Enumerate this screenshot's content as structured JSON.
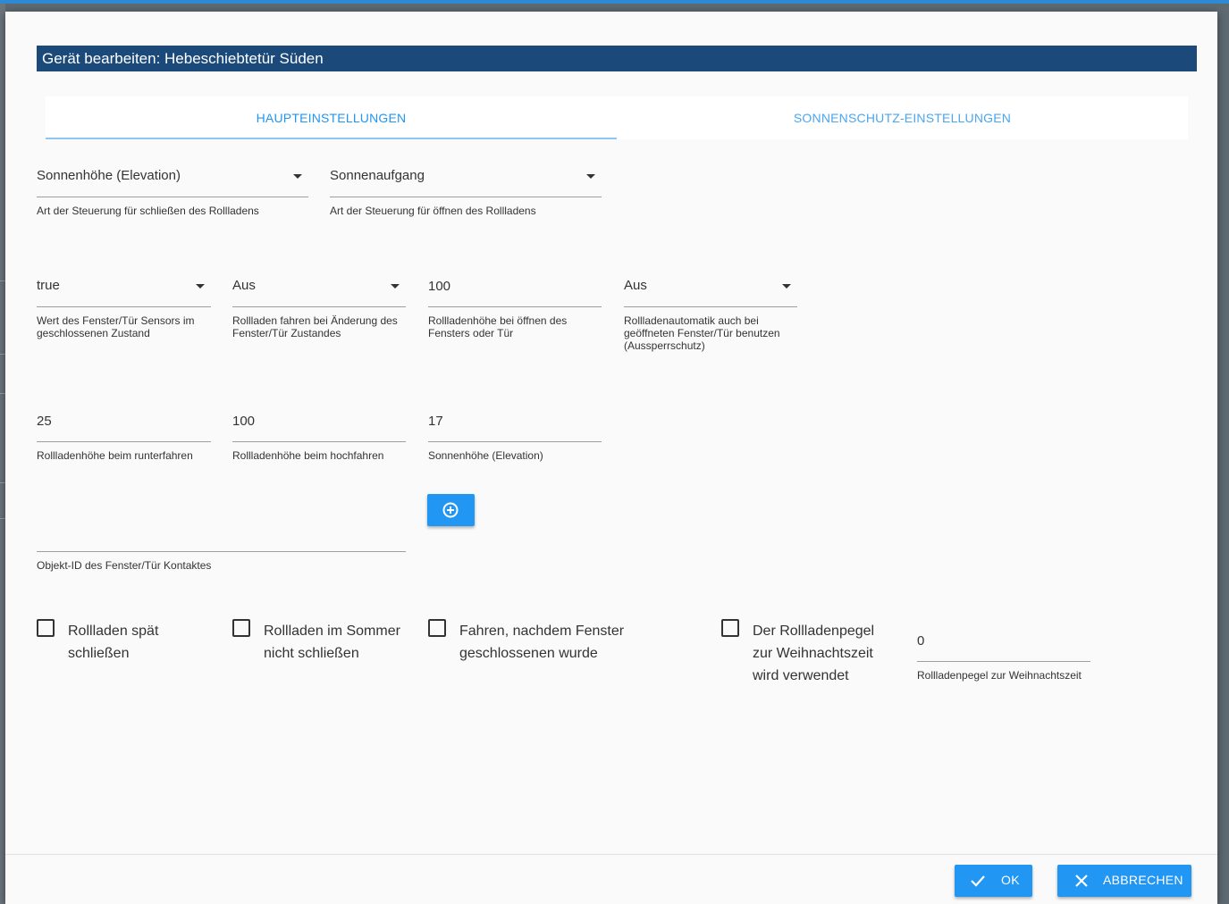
{
  "dialog": {
    "title": "Gerät bearbeiten: Hebeschiebtetür Süden"
  },
  "tabs": [
    {
      "label": "HAUPTEINSTELLUNGEN",
      "active": true
    },
    {
      "label": "SONNENSCHUTZ-EINSTELLUNGEN",
      "active": false
    }
  ],
  "fields": {
    "close_type": {
      "value": "Sonnenhöhe (Elevation)",
      "help": "Art der Steuerung für schließen des Rollladens"
    },
    "open_type": {
      "value": "Sonnenaufgang",
      "help": "Art der Steuerung für öffnen des Rollladens"
    },
    "sensor_closed_value": {
      "value": "true",
      "help": "Wert des Fenster/Tür Sensors im geschlossenen Zustand"
    },
    "move_on_change": {
      "value": "Aus",
      "help": "Rollladen fahren bei Änderung des Fenster/Tür Zustandes"
    },
    "open_height": {
      "value": "100",
      "help": "Rollladenhöhe bei öffnen des Fensters oder Tür"
    },
    "lockout": {
      "value": "Aus",
      "help": "Rollladenautomatik auch bei geöffneten Fenster/Tür benutzen (Aussperrschutz)"
    },
    "down_height": {
      "value": "25",
      "help": "Rollladenhöhe beim runterfahren"
    },
    "up_height": {
      "value": "100",
      "help": "Rollladenhöhe beim hochfahren"
    },
    "elevation": {
      "value": "17",
      "help": "Sonnenhöhe (Elevation)"
    },
    "contact_object_id": {
      "value": "",
      "help": "Objekt-ID des Fenster/Tür Kontaktes"
    },
    "xmas_level": {
      "value": "0",
      "help": "Rollladenpegel zur Weihnachtszeit"
    }
  },
  "checkboxes": [
    {
      "label": "Rollladen spät schließen",
      "checked": false
    },
    {
      "label": "Rollladen im Sommer nicht schließen",
      "checked": false
    },
    {
      "label": "Fahren, nachdem Fenster geschlossenen wurde",
      "checked": false
    },
    {
      "label": "Der Rollladenpegel zur Weihnachtszeit wird verwendet",
      "checked": false
    }
  ],
  "buttons": {
    "ok": "OK",
    "cancel": "ABBRECHEN"
  },
  "icons": {
    "add": "plus-circle-icon",
    "ok": "check-icon",
    "cancel": "close-icon"
  },
  "colors": {
    "accent": "#2196f3",
    "titlebar": "#1b4a7a"
  }
}
